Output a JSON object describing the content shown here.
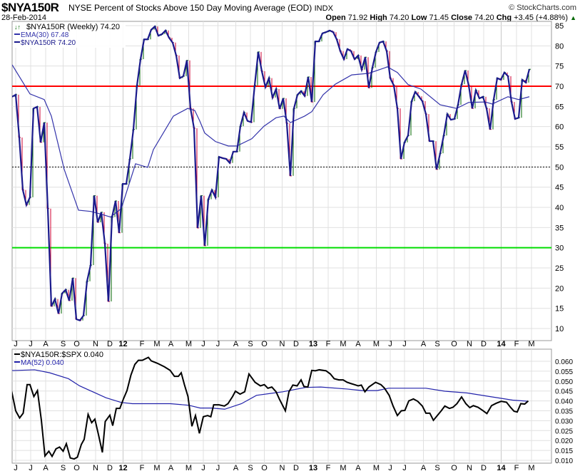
{
  "header": {
    "symbol": "$NYA150R",
    "description": "NYSE Percent of Stocks Above 150 Day Moving Average (EOD)",
    "exchange": "INDX",
    "brand": "© StockCharts.com",
    "date": "28-Feb-2014",
    "open_label": "Open",
    "open": "71.92",
    "high_label": "High",
    "high": "74.20",
    "low_label": "Low",
    "low": "71.45",
    "close_label": "Close",
    "close": "74.20",
    "chg_label": "Chg",
    "chg": "+3.45 (+4.88%)",
    "up_arrow": "▲"
  },
  "colors": {
    "price": "#1a1a8c",
    "ema": "#3333aa",
    "up": "#006600",
    "down": "#cc0033",
    "resistance": "#ff0000",
    "support": "#00dd00",
    "ratio": "#000000",
    "ma": "#2222aa"
  },
  "chart_data": [
    {
      "type": "line",
      "title": "$NYA150R (Weekly) 74.20",
      "x_unit": "weeks since first bar (Jun 2011)",
      "ylim": [
        7,
        86
      ],
      "yticks": [
        10,
        15,
        20,
        25,
        30,
        35,
        40,
        45,
        50,
        55,
        60,
        65,
        70,
        75,
        80,
        85
      ],
      "legend": [
        "$NYA150R (Weekly) 74.20",
        "EMA(30) 67.48",
        "$NYA150R 74.20"
      ],
      "legend_position": "top-left",
      "hlines": [
        {
          "value": 70,
          "color": "red"
        },
        {
          "value": 50,
          "color": "black-dotted"
        },
        {
          "value": 30,
          "color": "green"
        }
      ],
      "close": [
        67.4,
        67.9,
        57.3,
        44.3,
        40.6,
        42.5,
        64.5,
        64.9,
        56.1,
        61,
        39.7,
        15.5,
        17.3,
        13.7,
        18.7,
        19.6,
        16.9,
        22.5,
        12.3,
        12,
        13.2,
        21.7,
        25.7,
        42.9,
        36.3,
        38.8,
        31,
        16.7,
        37.6,
        41.6,
        33.7,
        45.8,
        45.8,
        52,
        59.3,
        70.2,
        76.7,
        81.6,
        81.6,
        84,
        84.8,
        82.5,
        82.9,
        83.8,
        82,
        80.8,
        77.6,
        72,
        72.5,
        76.4,
        64.5,
        59.6,
        34.9,
        42.9,
        30.5,
        42,
        44.3,
        42.5,
        52.5,
        52.2,
        52,
        51,
        53.8,
        53.8,
        60.1,
        63.5,
        61.4,
        61.1,
        70.2,
        78.5,
        73.7,
        69.8,
        72,
        67.2,
        69.3,
        64.4,
        67,
        60.8,
        47.8,
        64.5,
        67.9,
        68.8,
        67.6,
        72.3,
        66.1,
        81.1,
        81.1,
        83.1,
        83.4,
        83.8,
        83.4,
        81.6,
        78.7,
        76.7,
        79.2,
        78.7,
        76.7,
        77.6,
        74.1,
        77.2,
        69.6,
        74.6,
        78.5,
        80.8,
        81.1,
        78.7,
        72,
        70.2,
        64.5,
        52,
        56.1,
        57.8,
        66.3,
        68.6,
        67.5,
        66.3,
        63.1,
        56.4,
        56.4,
        49.4,
        53.4,
        57.8,
        63.1,
        61.7,
        61.9,
        65.4,
        70.5,
        73.9,
        70.2,
        64.5,
        69,
        67,
        67.4,
        64.5,
        59.3,
        66.7,
        72,
        71.6,
        73.4,
        72.5,
        66.1,
        61.9,
        62.2,
        71.6,
        70.9,
        74.2
      ],
      "ema30": [
        [
          0,
          75.3
        ],
        [
          5,
          68.1
        ],
        [
          9,
          66.7
        ],
        [
          11,
          62.6
        ],
        [
          14.6,
          49.4
        ],
        [
          18.6,
          39.3
        ],
        [
          22,
          39
        ],
        [
          24.6,
          38.4
        ],
        [
          27.6,
          37.6
        ],
        [
          30.6,
          39.7
        ],
        [
          34.6,
          50.8
        ],
        [
          38,
          49.9
        ],
        [
          39.6,
          54.3
        ],
        [
          45.2,
          62.6
        ],
        [
          49.2,
          64.5
        ],
        [
          51.2,
          64
        ],
        [
          52.6,
          61.4
        ],
        [
          54,
          58.4
        ],
        [
          57,
          56.3
        ],
        [
          60.6,
          55.2
        ],
        [
          63,
          55.2
        ],
        [
          67.2,
          57
        ],
        [
          70.6,
          60.1
        ],
        [
          74,
          62.2
        ],
        [
          76.2,
          62.6
        ],
        [
          78,
          61
        ],
        [
          82,
          62.6
        ],
        [
          84,
          63.7
        ],
        [
          87.2,
          67.9
        ],
        [
          90.6,
          70.5
        ],
        [
          95.2,
          72.8
        ],
        [
          100,
          73.2
        ],
        [
          104.6,
          74.6
        ],
        [
          105.2,
          74.8
        ],
        [
          108,
          73.4
        ],
        [
          111,
          70.4
        ],
        [
          114.6,
          69.3
        ],
        [
          120,
          65.4
        ],
        [
          124.6,
          64.5
        ],
        [
          128,
          66
        ],
        [
          132.6,
          66.1
        ],
        [
          134.6,
          65.6
        ],
        [
          139,
          67.4
        ],
        [
          142,
          66.7
        ],
        [
          145,
          67.4
        ]
      ]
    },
    {
      "type": "line",
      "title": "$NYA150R:$SPX 0.040",
      "ylim": [
        0.0085,
        0.0635
      ],
      "yticks": [
        0.01,
        0.015,
        0.02,
        0.025,
        0.03,
        0.035,
        0.04,
        0.045,
        0.05,
        0.055,
        0.06
      ],
      "legend": [
        "$NYA150R:$SPX 0.040",
        "MA(52) 0.040"
      ],
      "legend_position": "top-left",
      "ratio": [
        [
          -1.6,
          0.0506
        ],
        [
          -1.1,
          0.0512
        ],
        [
          -0.1,
          0.0446
        ],
        [
          1,
          0.035
        ],
        [
          2.1,
          0.0314
        ],
        [
          3.1,
          0.0338
        ],
        [
          4.2,
          0.0482
        ],
        [
          5,
          0.0482
        ],
        [
          6.1,
          0.0422
        ],
        [
          7.1,
          0.0452
        ],
        [
          8.2,
          0.0302
        ],
        [
          9.2,
          0.0122
        ],
        [
          10.3,
          0.0146
        ],
        [
          11.2,
          0.012
        ],
        [
          12.3,
          0.0158
        ],
        [
          13.3,
          0.0167
        ],
        [
          14.3,
          0.0146
        ],
        [
          15.2,
          0.0184
        ],
        [
          16.3,
          0.0112
        ],
        [
          17.4,
          0.0107
        ],
        [
          18.3,
          0.0116
        ],
        [
          19.4,
          0.018
        ],
        [
          20.2,
          0.0206
        ],
        [
          21.3,
          0.0332
        ],
        [
          22.3,
          0.029
        ],
        [
          23.2,
          0.0308
        ],
        [
          24.2,
          0.023
        ],
        [
          25.3,
          0.014
        ],
        [
          26.1,
          0.0296
        ],
        [
          27.4,
          0.0328
        ],
        [
          28.2,
          0.0275
        ],
        [
          29.2,
          0.0362
        ],
        [
          30.2,
          0.0362
        ],
        [
          31.2,
          0.041
        ],
        [
          32.2,
          0.0452
        ],
        [
          33.3,
          0.053
        ],
        [
          34.4,
          0.0584
        ],
        [
          35.4,
          0.0605
        ],
        [
          36.5,
          0.0605
        ],
        [
          38.2,
          0.062
        ],
        [
          39,
          0.0602
        ],
        [
          40.7,
          0.059
        ],
        [
          42.7,
          0.0572
        ],
        [
          44.3,
          0.0554
        ],
        [
          45.5,
          0.0524
        ],
        [
          46.6,
          0.0524
        ],
        [
          47.4,
          0.0542
        ],
        [
          48.3,
          0.0482
        ],
        [
          49.3,
          0.0422
        ],
        [
          50.4,
          0.0272
        ],
        [
          51.4,
          0.0326
        ],
        [
          52.5,
          0.0236
        ],
        [
          53.6,
          0.032
        ],
        [
          54.8,
          0.0326
        ],
        [
          55.7,
          0.032
        ],
        [
          56.5,
          0.038
        ],
        [
          58,
          0.038
        ],
        [
          59.5,
          0.0374
        ],
        [
          60.5,
          0.0386
        ],
        [
          61.8,
          0.0422
        ],
        [
          62.6,
          0.0449
        ],
        [
          63.9,
          0.0434
        ],
        [
          65.2,
          0.0446
        ],
        [
          66.4,
          0.0536
        ],
        [
          68.1,
          0.0494
        ],
        [
          69.6,
          0.0476
        ],
        [
          70.7,
          0.0482
        ],
        [
          71.7,
          0.0464
        ],
        [
          72.8,
          0.047
        ],
        [
          74,
          0.0446
        ],
        [
          74.9,
          0.041
        ],
        [
          76.6,
          0.035
        ],
        [
          77.6,
          0.0446
        ],
        [
          78.7,
          0.048
        ],
        [
          79.9,
          0.0476
        ],
        [
          81,
          0.0506
        ],
        [
          81.8,
          0.0473
        ],
        [
          82.9,
          0.047
        ],
        [
          84,
          0.0554
        ],
        [
          85,
          0.0552
        ],
        [
          86.1,
          0.0557
        ],
        [
          88,
          0.0552
        ],
        [
          89.2,
          0.0536
        ],
        [
          90.3,
          0.0512
        ],
        [
          91.6,
          0.0506
        ],
        [
          92.8,
          0.0506
        ],
        [
          93.9,
          0.0494
        ],
        [
          94.9,
          0.0488
        ],
        [
          96,
          0.0482
        ],
        [
          97,
          0.0476
        ],
        [
          97.9,
          0.048
        ],
        [
          98.9,
          0.0446
        ],
        [
          100,
          0.047
        ],
        [
          101.9,
          0.0494
        ],
        [
          103.4,
          0.0482
        ],
        [
          104.4,
          0.0464
        ],
        [
          105.7,
          0.0428
        ],
        [
          106.8,
          0.0374
        ],
        [
          108,
          0.0326
        ],
        [
          109.1,
          0.035
        ],
        [
          110.1,
          0.0352
        ],
        [
          111.2,
          0.04
        ],
        [
          112.5,
          0.041
        ],
        [
          113.7,
          0.0398
        ],
        [
          115,
          0.0374
        ],
        [
          116,
          0.0338
        ],
        [
          117.1,
          0.0338
        ],
        [
          118.1,
          0.0302
        ],
        [
          119.2,
          0.0326
        ],
        [
          120.3,
          0.035
        ],
        [
          121.3,
          0.0374
        ],
        [
          122.6,
          0.0362
        ],
        [
          123.6,
          0.0368
        ],
        [
          124.7,
          0.0386
        ],
        [
          126,
          0.042
        ],
        [
          127.2,
          0.0386
        ],
        [
          128.3,
          0.0366
        ],
        [
          129.3,
          0.0376
        ],
        [
          130.6,
          0.0368
        ],
        [
          131.9,
          0.0352
        ],
        [
          133.1,
          0.0336
        ],
        [
          134.4,
          0.0376
        ],
        [
          135.7,
          0.0388
        ],
        [
          137.1,
          0.0398
        ],
        [
          138.6,
          0.0393
        ],
        [
          139.7,
          0.0368
        ],
        [
          140.7,
          0.0348
        ],
        [
          141.6,
          0.0344
        ],
        [
          142.6,
          0.0386
        ],
        [
          143.7,
          0.0384
        ],
        [
          144.7,
          0.04
        ]
      ],
      "ma52": [
        [
          -1.6,
          0.0552
        ],
        [
          6.3,
          0.0557
        ],
        [
          10.5,
          0.0542
        ],
        [
          15.8,
          0.0512
        ],
        [
          18.9,
          0.0476
        ],
        [
          26.3,
          0.0416
        ],
        [
          30.6,
          0.0392
        ],
        [
          33.7,
          0.0386
        ],
        [
          44.3,
          0.0386
        ],
        [
          49.5,
          0.0378
        ],
        [
          52.7,
          0.0364
        ],
        [
          55.9,
          0.0364
        ],
        [
          59.6,
          0.0358
        ],
        [
          64.3,
          0.0386
        ],
        [
          68.5,
          0.0428
        ],
        [
          75.9,
          0.0446
        ],
        [
          82.3,
          0.0468
        ],
        [
          86.5,
          0.047
        ],
        [
          93.9,
          0.046
        ],
        [
          98.1,
          0.0452
        ],
        [
          102.3,
          0.0452
        ],
        [
          105.5,
          0.0464
        ],
        [
          116,
          0.0464
        ],
        [
          121.3,
          0.0449
        ],
        [
          127.6,
          0.044
        ],
        [
          133.9,
          0.0422
        ],
        [
          140.3,
          0.0404
        ],
        [
          144.7,
          0.0398
        ]
      ]
    }
  ],
  "x_axis": [
    {
      "label": "J",
      "w": 1
    },
    {
      "label": "J",
      "w": 5.2
    },
    {
      "label": "A",
      "w": 9.4
    },
    {
      "label": "S",
      "w": 14.3
    },
    {
      "label": "O",
      "w": 18.1
    },
    {
      "label": "N",
      "w": 23.4
    },
    {
      "label": "D",
      "w": 27.4
    },
    {
      "label": "12",
      "w": 31.1,
      "year": true
    },
    {
      "label": "F",
      "w": 36.4
    },
    {
      "label": "M",
      "w": 40.6
    },
    {
      "label": "A",
      "w": 44.5
    },
    {
      "label": "M",
      "w": 49.5
    },
    {
      "label": "J",
      "w": 53.6
    },
    {
      "label": "J",
      "w": 57.7
    },
    {
      "label": "A",
      "w": 62.7
    },
    {
      "label": "S",
      "w": 66.8
    },
    {
      "label": "O",
      "w": 70.7
    },
    {
      "label": "N",
      "w": 75.7
    },
    {
      "label": "D",
      "w": 79.6
    },
    {
      "label": "13",
      "w": 84.4,
      "year": true
    },
    {
      "label": "F",
      "w": 88.6
    },
    {
      "label": "M",
      "w": 92.8
    },
    {
      "label": "A",
      "w": 97
    },
    {
      "label": "M",
      "w": 102.1
    },
    {
      "label": "J",
      "w": 106
    },
    {
      "label": "J",
      "w": 110
    },
    {
      "label": "A",
      "w": 115.3
    },
    {
      "label": "S",
      "w": 119.2
    },
    {
      "label": "O",
      "w": 123.9
    },
    {
      "label": "N",
      "w": 128.2
    },
    {
      "label": "D",
      "w": 132.2
    },
    {
      "label": "14",
      "w": 137.1,
      "year": true
    },
    {
      "label": "F",
      "w": 141.4
    },
    {
      "label": "M",
      "w": 145.6
    }
  ]
}
